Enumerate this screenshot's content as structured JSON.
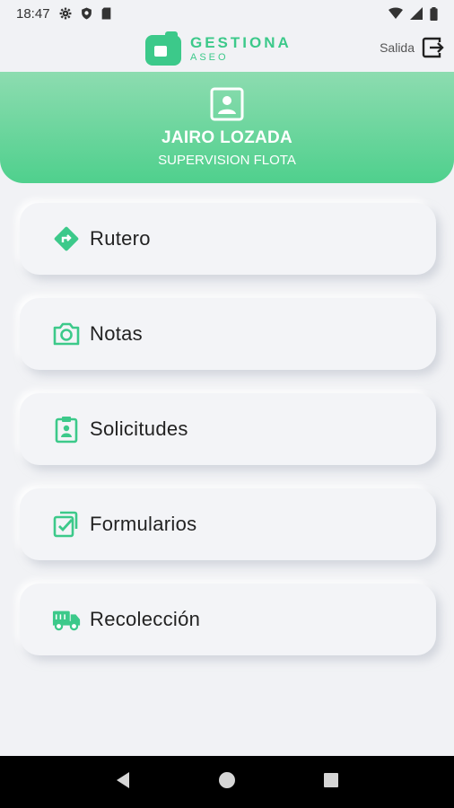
{
  "status": {
    "time": "18:47"
  },
  "app": {
    "title": "GESTIONA",
    "subtitle": "ASEO",
    "exit_label": "Salida"
  },
  "user": {
    "name": "JAIRO LOZADA",
    "role": "SUPERVISION FLOTA"
  },
  "menu": [
    {
      "label": "Rutero",
      "icon": "route-sign-icon"
    },
    {
      "label": "Notas",
      "icon": "camera-icon"
    },
    {
      "label": "Solicitudes",
      "icon": "clipboard-user-icon"
    },
    {
      "label": "Formularios",
      "icon": "checklist-icon"
    },
    {
      "label": "Recolección",
      "icon": "truck-icon"
    }
  ],
  "colors": {
    "accent": "#3cc98a",
    "header_top": "#8ddcb0",
    "header_bottom": "#4fd08d",
    "background": "#f1f2f5"
  }
}
